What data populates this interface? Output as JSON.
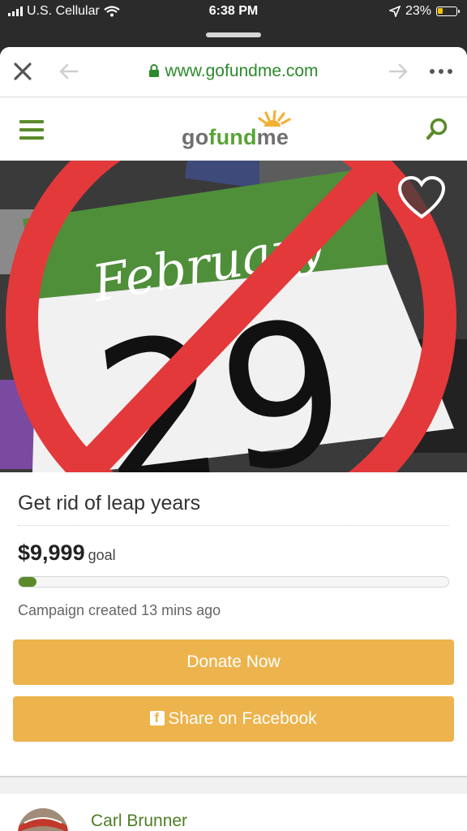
{
  "status": {
    "carrier": "U.S. Cellular",
    "time": "6:38 PM",
    "battery": "23%",
    "battery_level": 0.23
  },
  "browser": {
    "url": "www.gofundme.com"
  },
  "site": {
    "logo": {
      "go": "go",
      "fund": "fund",
      "me": "me"
    }
  },
  "hero": {
    "month": "February",
    "day": "29"
  },
  "campaign": {
    "title": "Get rid of leap years",
    "amount": "$9,999",
    "goal_label": "goal",
    "progress": 0.04,
    "created": "Campaign created 13 mins ago",
    "donate_label": "Donate Now",
    "share_label": "Share on Facebook"
  },
  "organizer": {
    "name": "Carl Brunner"
  },
  "colors": {
    "brand_green": "#5b8a2a",
    "button_orange": "#edb34c",
    "url_green": "#2c8a2c"
  }
}
